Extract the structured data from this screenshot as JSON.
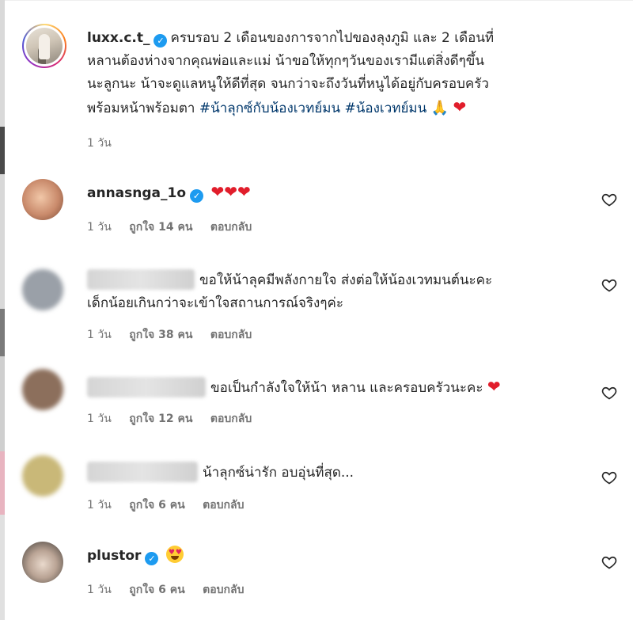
{
  "post": {
    "username": "luxx.c.t_",
    "verified": true,
    "caption_line1": "ครบรอบ 2 เดือนของการจากไปของลุงภูมิ และ 2 เดือนที่",
    "caption_line2": "หลานต้องห่างจากคุณพ่อและแม่ น้าขอให้ทุกๆวันของเรามีแต่สิ่งดีๆขึ้น",
    "caption_line3": "นะลูกนะ น้าจะดูแลหนูให้ดีที่สุด จนกว่าจะถึงวันที่หนูได้อยู่กับครอบครัว",
    "caption_line4_text": "พร้อมหน้าพร้อมตา",
    "hashtag1": "#น้าลุกซ์กับน้องเวทย์มน",
    "hashtag2": "#น้องเวทย์มน",
    "emoji_pray": "🙏",
    "emoji_heart": "❤",
    "time": "1 วัน"
  },
  "comments": [
    {
      "username": "annasnga_1o",
      "verified": true,
      "text": "❤❤❤",
      "time": "1 วัน",
      "likes": "ถูกใจ 14 คน",
      "reply": "ตอบกลับ",
      "avatar_color": "#c98a6b"
    },
    {
      "username": "",
      "text_line1": "ขอให้น้าลุคมีพลังกายใจ ส่งต่อให้น้องเวทมนต์นะคะ",
      "text_line2": "เด็กน้อยเกินกว่าจะเข้าใจสถานการณ์จริงๆค่ะ",
      "time": "1 วัน",
      "likes": "ถูกใจ 38 คน",
      "reply": "ตอบกลับ",
      "avatar_color": "#9aa0a8"
    },
    {
      "username": "",
      "text": "ขอเป็นกำลังใจให้น้า หลาน และครอบครัวนะคะ",
      "emoji": "❤",
      "time": "1 วัน",
      "likes": "ถูกใจ 12 คน",
      "reply": "ตอบกลับ",
      "avatar_color": "#8c6f5c"
    },
    {
      "username": "",
      "text": "น้าลุกซ์น่ารัก อบอุ่นที่สุด...",
      "time": "1 วัน",
      "likes": "ถูกใจ 6 คน",
      "reply": "ตอบกลับ",
      "avatar_color": "#c9b878"
    },
    {
      "username": "plustor",
      "verified": true,
      "emoji_name": "heart-eyes-emoji",
      "time": "1 วัน",
      "likes": "ถูกใจ 6 คน",
      "reply": "ตอบกลับ",
      "avatar_color": "#6f6a66"
    }
  ],
  "colors": {
    "text": "#262626",
    "meta": "#737373",
    "hashtag": "#00376b",
    "verified": "#1d9bf0",
    "heart": "#e11d2b"
  }
}
